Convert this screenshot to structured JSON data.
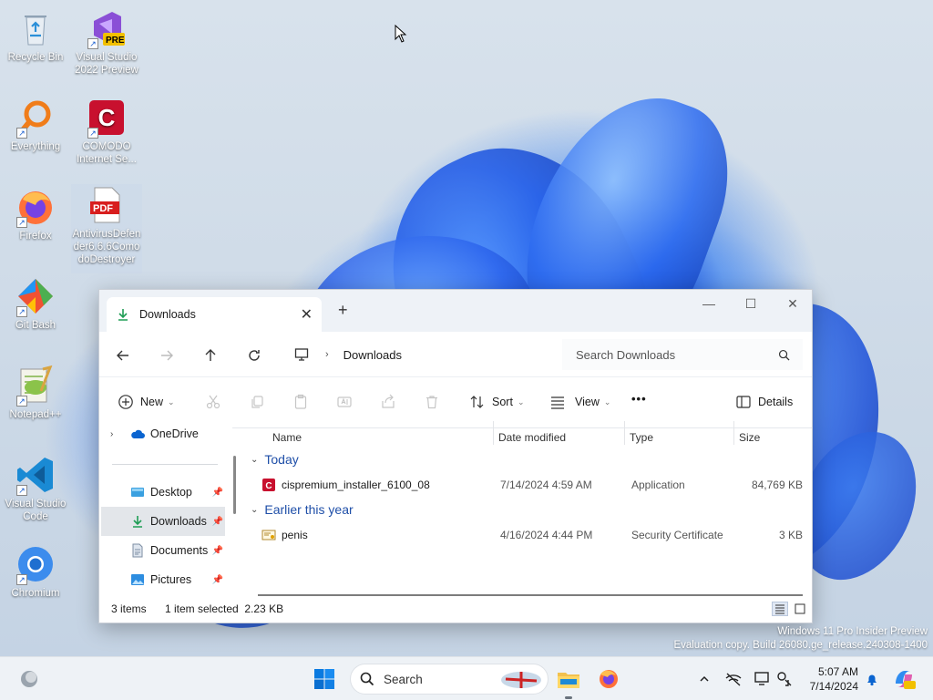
{
  "desktop": {
    "icons": [
      {
        "label": "Recycle Bin",
        "icon": "recycle-bin-icon"
      },
      {
        "label": "Visual Studio 2022 Preview",
        "icon": "visual-studio-preview-icon",
        "badge": "PRE"
      },
      {
        "label": "Everything",
        "icon": "everything-search-icon"
      },
      {
        "label": "COMODO Internet Se...",
        "icon": "comodo-icon"
      },
      {
        "label": "Firefox",
        "icon": "firefox-icon"
      },
      {
        "label": "AntivirusDefender6.6.6ComodoDestroyer",
        "icon": "pdf-file-icon",
        "badge": "PDF"
      },
      {
        "label": "Git Bash",
        "icon": "git-bash-icon"
      },
      {
        "label": "Notepad++",
        "icon": "notepad-plus-plus-icon"
      },
      {
        "label": "Visual Studio Code",
        "icon": "vscode-icon"
      },
      {
        "label": "Chromium",
        "icon": "chromium-icon"
      }
    ]
  },
  "explorer": {
    "tab_title": "Downloads",
    "breadcrumb": "Downloads",
    "search_placeholder": "Search Downloads",
    "toolbar": {
      "new": "New",
      "sort": "Sort",
      "view": "View",
      "more": "•••",
      "details": "Details"
    },
    "nav": {
      "onedrive": "OneDrive",
      "items": [
        {
          "label": "Desktop"
        },
        {
          "label": "Downloads"
        },
        {
          "label": "Documents"
        },
        {
          "label": "Pictures"
        }
      ]
    },
    "columns": [
      "Name",
      "Date modified",
      "Type",
      "Size"
    ],
    "groups": [
      {
        "label": "Today",
        "files": [
          {
            "name": "cispremium_installer_6100_08",
            "date": "7/14/2024 4:59 AM",
            "type": "Application",
            "size": "84,769 KB"
          }
        ]
      },
      {
        "label": "Earlier this year",
        "files": [
          {
            "name": "penis",
            "date": "4/16/2024 4:44 PM",
            "type": "Security Certificate",
            "size": "3 KB"
          }
        ]
      }
    ],
    "status": {
      "count": "3 items",
      "selected": "1 item selected  2.23 KB"
    }
  },
  "watermark": {
    "line1": "Windows 11 Pro Insider Preview",
    "line2": "Evaluation copy. Build 26080.ge_release.240308-1400"
  },
  "taskbar": {
    "search_label": "Search",
    "time": "5:07 AM",
    "date": "7/14/2024"
  },
  "colors": {
    "accent": "#0067c0",
    "folder": "#f2c14e"
  }
}
